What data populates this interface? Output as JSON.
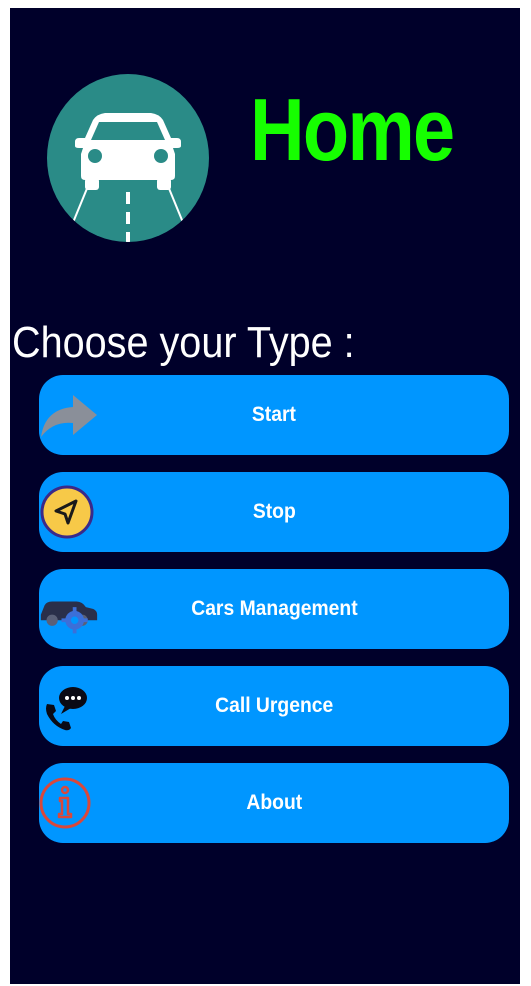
{
  "header": {
    "title": "Home",
    "logo_icon": "car-road-icon",
    "title_color": "#16ff00"
  },
  "subtitle": "Choose your Type :",
  "menu": {
    "items": [
      {
        "label": "Start",
        "icon": "forward-arrow-icon"
      },
      {
        "label": "Stop",
        "icon": "navigation-arrow-icon"
      },
      {
        "label": "Cars Management",
        "icon": "car-gear-icon"
      },
      {
        "label": "Call Urgence",
        "icon": "phone-chat-icon"
      },
      {
        "label": "About",
        "icon": "info-icon"
      }
    ]
  },
  "colors": {
    "background": "#00002a",
    "button": "#0096ff",
    "logo_circle": "#2a8b87"
  }
}
